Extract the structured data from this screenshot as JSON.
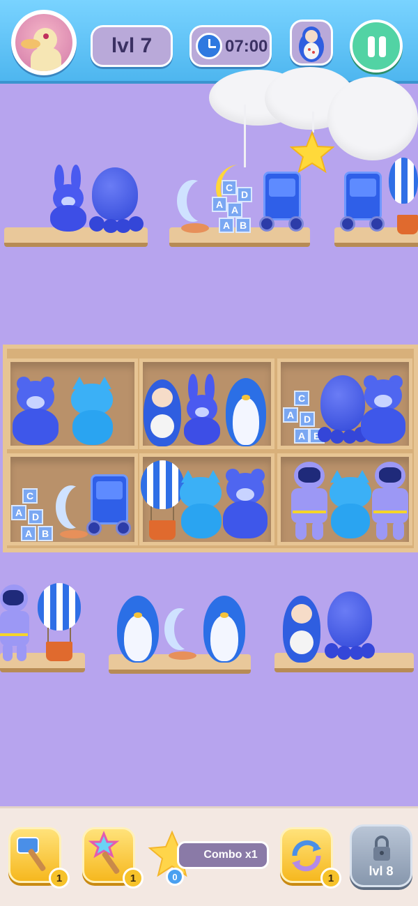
{
  "header": {
    "level_label": "lvl 7",
    "timer": "07:00",
    "avatar_icon": "duck-avatar-icon",
    "target_icon": "matryoshka-doll-icon",
    "pause_icon": "pause-icon"
  },
  "footer": {
    "boosters": [
      {
        "icon": "hammer-icon",
        "count": "1"
      },
      {
        "icon": "magic-wand-icon",
        "count": "1"
      },
      {
        "icon": "shuffle-icon",
        "count": "1"
      }
    ],
    "combo_label": "Combo x1",
    "combo_count": "0",
    "locked_label": "lvl 8"
  },
  "colors": {
    "background": "#b7a4ee",
    "topbar": "#4eb6ef",
    "pause_button": "#52d3a4",
    "booster": "#f6b81f"
  }
}
